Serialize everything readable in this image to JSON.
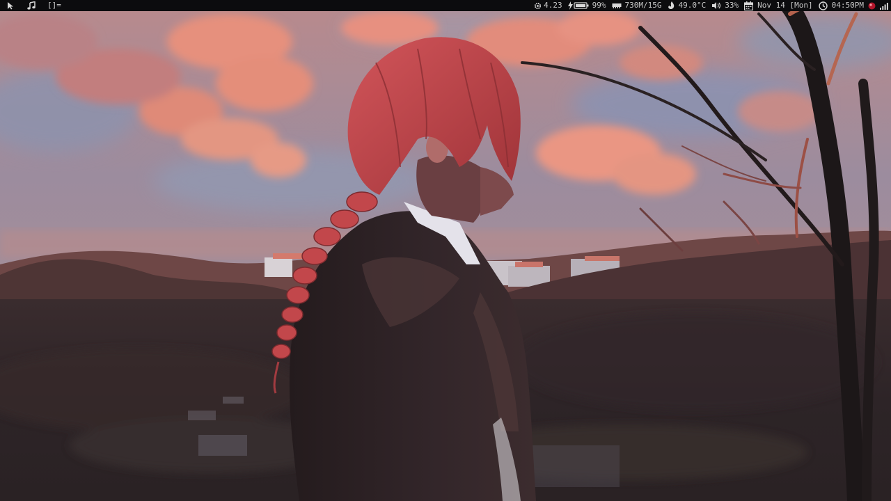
{
  "statusbar": {
    "left": {
      "launcher_icon": "pointer-icon",
      "music_icon": "music-note-icon",
      "layout_symbol": "[]="
    },
    "right": {
      "cpu_icon": "cpu-gear-icon",
      "cpu_load": "4.23",
      "battery_icon": "battery-charging-icon",
      "battery": "99%",
      "memory_icon": "memory-chip-icon",
      "memory": "730M/15G",
      "temp_icon": "thermometer-flame-icon",
      "temperature": "49.0°C",
      "volume_icon": "speaker-volume-icon",
      "volume": "33%",
      "calendar_icon": "calendar-icon",
      "date": "Nov 14 [Mon]",
      "clock_icon": "clock-icon",
      "time": "04:50PM",
      "tray_icon": "red-orb-icon",
      "signal_icon": "signal-bars-icon"
    }
  },
  "colors": {
    "bar_bg": "#0c0c0e",
    "bar_fg": "#c9c9c9",
    "sky_pink": "#e58a78",
    "sky_blue": "#8f97ad",
    "hair_red": "#c4474c",
    "coat_dark": "#2b2022",
    "ground_dark": "#2f2628"
  }
}
